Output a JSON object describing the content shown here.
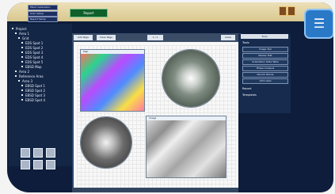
{
  "topbar": {
    "field1": "EDAX Calibration",
    "field2": "Scan Setup",
    "field3": "Report Setup",
    "green_button": "Report"
  },
  "left_tree": {
    "items": [
      "Project",
      "Area 1",
      "Grid",
      "EDS Spot 1",
      "EDS Spot 2",
      "EDS Spot 3",
      "EDS Spot 4",
      "EDS Spot 5",
      "EBSD Map",
      "Area 2",
      "Reference Area",
      "Area 3",
      "EBSD Spot 1",
      "EBSD Spot 2",
      "EBSD Spot 3",
      "EBSD Spot 4"
    ]
  },
  "workspace": {
    "toolbar_left": "Add Page",
    "toolbar_mid": "Clear Page",
    "toolbar_num": "1 / 1",
    "toolbar_right": "Close"
  },
  "right_panel": {
    "header": "Tools",
    "items": [
      "Image Tool",
      "Marker Edit",
      "Orientation Data Table",
      "Phase Analysis",
      "Kikuchi Bands",
      "Add Label"
    ],
    "section2": "Report",
    "section3": "Templates"
  }
}
